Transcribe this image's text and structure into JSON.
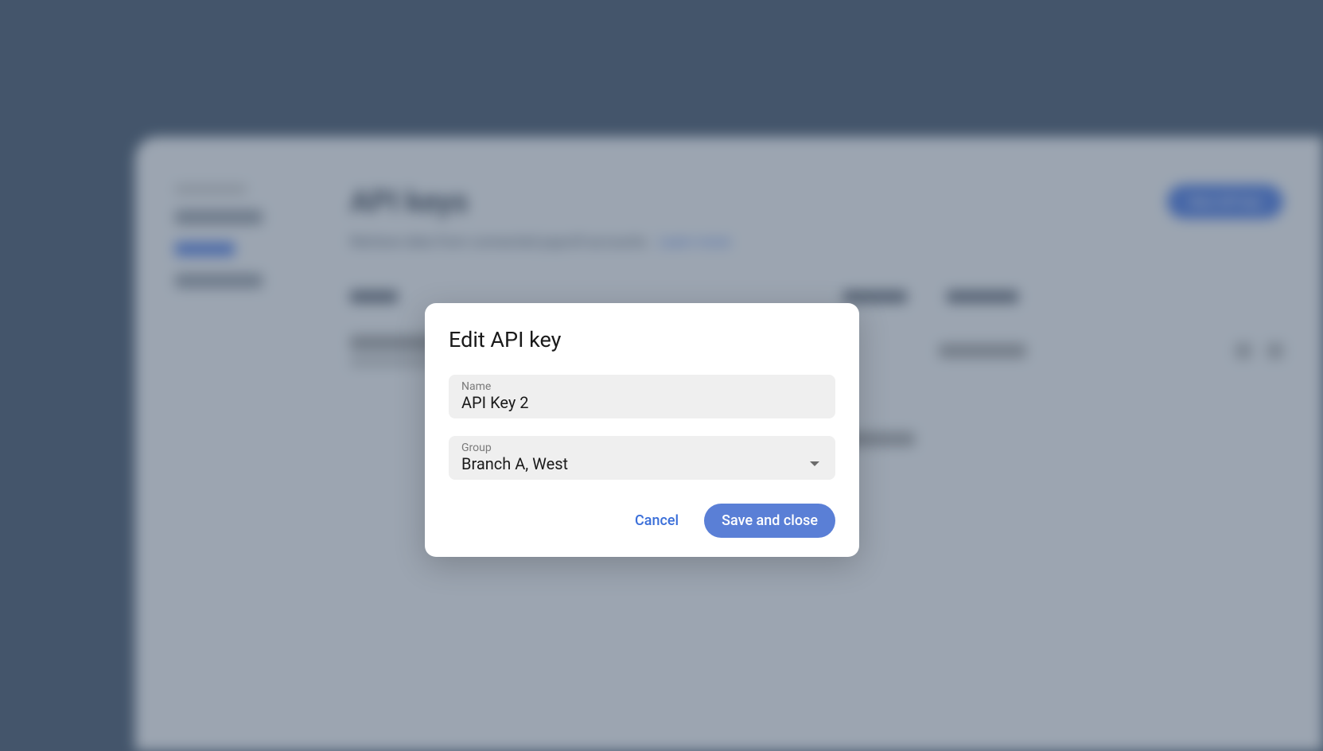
{
  "background": {
    "page_title": "API keys",
    "subtitle": "Retrieve data from connected payroll accounts.",
    "subtitle_link": "Learn more",
    "new_button": "New API key",
    "sidebar": {
      "items": [
        {
          "label": "Integrations",
          "active": false
        },
        {
          "label": "API keys",
          "active": true
        },
        {
          "label": "Webhooks",
          "active": false
        }
      ]
    },
    "table": {
      "columns": [
        "Name",
        "Created",
        "Last used"
      ]
    }
  },
  "modal": {
    "title": "Edit API key",
    "name_field": {
      "label": "Name",
      "value": "API Key 2"
    },
    "group_field": {
      "label": "Group",
      "value": "Branch A, West"
    },
    "cancel_label": "Cancel",
    "save_label": "Save and close"
  },
  "colors": {
    "bg": "#44556b",
    "panel": "#f4f5f7",
    "primary": "#5a7fd6",
    "link": "#3b6fd9",
    "field_bg": "#efefef"
  }
}
